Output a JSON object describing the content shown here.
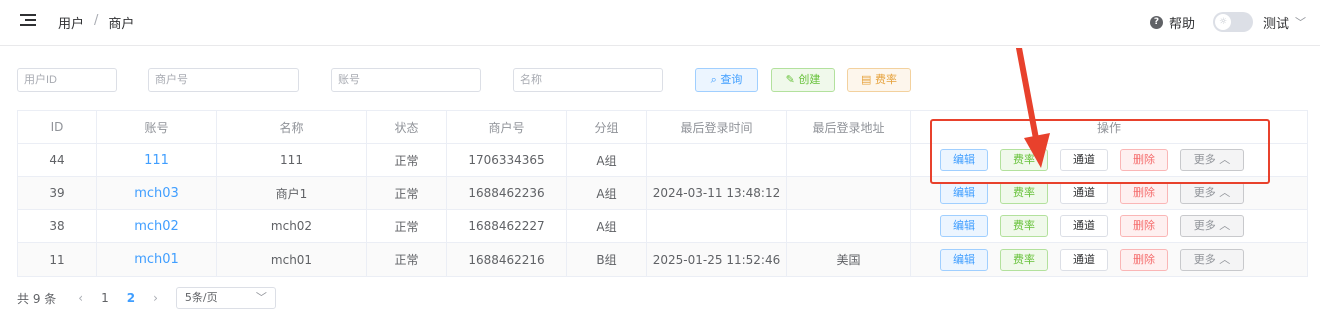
{
  "header": {
    "breadcrumb": [
      "用户",
      "商户"
    ],
    "breadcrumb_sep": "/",
    "help_label": "帮助",
    "user_label": "测试"
  },
  "search": {
    "user_id_placeholder": "用户ID",
    "mch_no_placeholder": "商户号",
    "account_placeholder": "账号",
    "name_placeholder": "名称",
    "query_label": "查询",
    "create_label": "创建",
    "rate_label": "费率"
  },
  "table": {
    "columns": [
      "ID",
      "账号",
      "名称",
      "状态",
      "商户号",
      "分组",
      "最后登录时间",
      "最后登录地址",
      "操作"
    ],
    "rows": [
      {
        "id": "44",
        "account": "111",
        "name": "111",
        "status": "正常",
        "mch_no": "1706334365",
        "group": "A组",
        "last_login_time": "",
        "last_login_addr": ""
      },
      {
        "id": "39",
        "account": "mch03",
        "name": "商户1",
        "status": "正常",
        "mch_no": "1688462236",
        "group": "A组",
        "last_login_time": "2024-03-11 13:48:12",
        "last_login_addr": ""
      },
      {
        "id": "38",
        "account": "mch02",
        "name": "mch02",
        "status": "正常",
        "mch_no": "1688462227",
        "group": "A组",
        "last_login_time": "",
        "last_login_addr": ""
      },
      {
        "id": "11",
        "account": "mch01",
        "name": "mch01",
        "status": "正常",
        "mch_no": "1688462216",
        "group": "B组",
        "last_login_time": "2025-01-25 11:52:46",
        "last_login_addr": "美国"
      }
    ],
    "ops": {
      "edit": "编辑",
      "rate": "费率",
      "channel": "通道",
      "delete": "删除",
      "more": "更多"
    }
  },
  "pagination": {
    "total_label": "共 9 条",
    "pages": [
      "1",
      "2"
    ],
    "current_page": "2",
    "page_size": "5条/页"
  },
  "colors": {
    "primary": "#409eff",
    "success": "#67c23a",
    "warning": "#e6a23c",
    "danger": "#f56c6c",
    "annotation": "#e8412c"
  }
}
